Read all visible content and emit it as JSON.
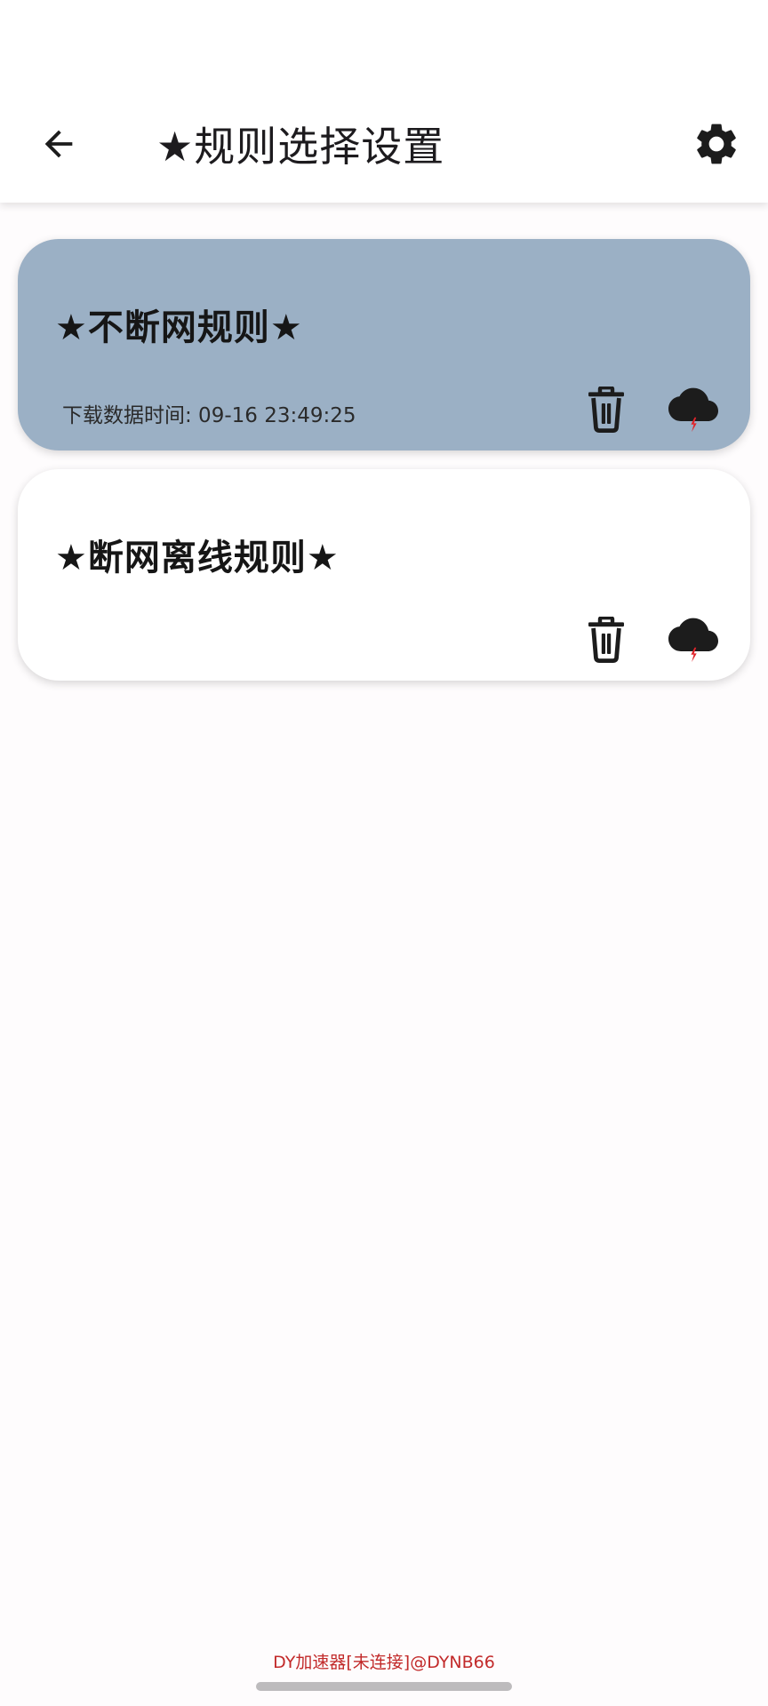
{
  "colors": {
    "background": "#fefcfd",
    "app_bar": "#ffffff",
    "selected_card": "#9bb0c5",
    "card": "#ffffff",
    "icon_dark": "#1c1c1c",
    "bolt_red": "#e0242a",
    "footer_text": "#c22a2a"
  },
  "header": {
    "back_icon": "arrow-left-icon",
    "title": "★规则选择设置",
    "settings_icon": "gear-icon"
  },
  "rules": [
    {
      "title": "★不断网规则★",
      "subtitle": "下载数据时间: 09-16 23:49:25",
      "selected": true,
      "delete_icon": "trash-icon",
      "download_icon": "cloud-lightning-icon"
    },
    {
      "title": "★断网离线规则★",
      "subtitle": "",
      "selected": false,
      "delete_icon": "trash-icon",
      "download_icon": "cloud-lightning-icon"
    }
  ],
  "footer": {
    "text": "DY加速器[未连接]@DYNB66"
  }
}
